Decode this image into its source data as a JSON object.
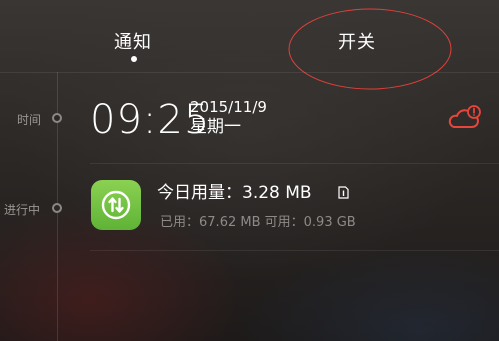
{
  "tabs": {
    "notify_label": "通知",
    "switch_label": "开关"
  },
  "timeline": {
    "time_label": "时间",
    "ongoing_label": "进行中"
  },
  "clock": {
    "time": "09:25",
    "date": "2015/11/9",
    "weekday": "星期一"
  },
  "weather": {
    "icon": "cloud-alert-icon",
    "color": "#e8453c"
  },
  "data_usage": {
    "icon": "data-transfer-icon",
    "icon_color": "#6cbf3f",
    "title_prefix": "今日用量：",
    "title_value": "3.28 MB",
    "used_label": "已用：",
    "used_value": "67.62 MB",
    "available_label": "可用：",
    "available_value": "0.93 GB"
  },
  "annotation": {
    "color": "#e0413a"
  }
}
